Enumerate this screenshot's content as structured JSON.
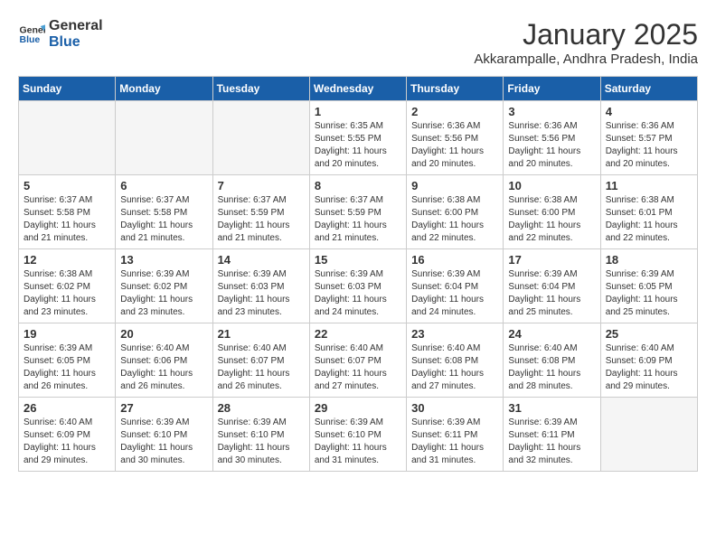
{
  "header": {
    "logo_general": "General",
    "logo_blue": "Blue",
    "month": "January 2025",
    "location": "Akkarampalle, Andhra Pradesh, India"
  },
  "weekdays": [
    "Sunday",
    "Monday",
    "Tuesday",
    "Wednesday",
    "Thursday",
    "Friday",
    "Saturday"
  ],
  "weeks": [
    [
      {
        "day": "",
        "empty": true
      },
      {
        "day": "",
        "empty": true
      },
      {
        "day": "",
        "empty": true
      },
      {
        "day": "1",
        "sunrise": "6:35 AM",
        "sunset": "5:55 PM",
        "daylight": "11 hours and 20 minutes."
      },
      {
        "day": "2",
        "sunrise": "6:36 AM",
        "sunset": "5:56 PM",
        "daylight": "11 hours and 20 minutes."
      },
      {
        "day": "3",
        "sunrise": "6:36 AM",
        "sunset": "5:56 PM",
        "daylight": "11 hours and 20 minutes."
      },
      {
        "day": "4",
        "sunrise": "6:36 AM",
        "sunset": "5:57 PM",
        "daylight": "11 hours and 20 minutes."
      }
    ],
    [
      {
        "day": "5",
        "sunrise": "6:37 AM",
        "sunset": "5:58 PM",
        "daylight": "11 hours and 21 minutes."
      },
      {
        "day": "6",
        "sunrise": "6:37 AM",
        "sunset": "5:58 PM",
        "daylight": "11 hours and 21 minutes."
      },
      {
        "day": "7",
        "sunrise": "6:37 AM",
        "sunset": "5:59 PM",
        "daylight": "11 hours and 21 minutes."
      },
      {
        "day": "8",
        "sunrise": "6:37 AM",
        "sunset": "5:59 PM",
        "daylight": "11 hours and 21 minutes."
      },
      {
        "day": "9",
        "sunrise": "6:38 AM",
        "sunset": "6:00 PM",
        "daylight": "11 hours and 22 minutes."
      },
      {
        "day": "10",
        "sunrise": "6:38 AM",
        "sunset": "6:00 PM",
        "daylight": "11 hours and 22 minutes."
      },
      {
        "day": "11",
        "sunrise": "6:38 AM",
        "sunset": "6:01 PM",
        "daylight": "11 hours and 22 minutes."
      }
    ],
    [
      {
        "day": "12",
        "sunrise": "6:38 AM",
        "sunset": "6:02 PM",
        "daylight": "11 hours and 23 minutes."
      },
      {
        "day": "13",
        "sunrise": "6:39 AM",
        "sunset": "6:02 PM",
        "daylight": "11 hours and 23 minutes."
      },
      {
        "day": "14",
        "sunrise": "6:39 AM",
        "sunset": "6:03 PM",
        "daylight": "11 hours and 23 minutes."
      },
      {
        "day": "15",
        "sunrise": "6:39 AM",
        "sunset": "6:03 PM",
        "daylight": "11 hours and 24 minutes."
      },
      {
        "day": "16",
        "sunrise": "6:39 AM",
        "sunset": "6:04 PM",
        "daylight": "11 hours and 24 minutes."
      },
      {
        "day": "17",
        "sunrise": "6:39 AM",
        "sunset": "6:04 PM",
        "daylight": "11 hours and 25 minutes."
      },
      {
        "day": "18",
        "sunrise": "6:39 AM",
        "sunset": "6:05 PM",
        "daylight": "11 hours and 25 minutes."
      }
    ],
    [
      {
        "day": "19",
        "sunrise": "6:39 AM",
        "sunset": "6:05 PM",
        "daylight": "11 hours and 26 minutes."
      },
      {
        "day": "20",
        "sunrise": "6:40 AM",
        "sunset": "6:06 PM",
        "daylight": "11 hours and 26 minutes."
      },
      {
        "day": "21",
        "sunrise": "6:40 AM",
        "sunset": "6:07 PM",
        "daylight": "11 hours and 26 minutes."
      },
      {
        "day": "22",
        "sunrise": "6:40 AM",
        "sunset": "6:07 PM",
        "daylight": "11 hours and 27 minutes."
      },
      {
        "day": "23",
        "sunrise": "6:40 AM",
        "sunset": "6:08 PM",
        "daylight": "11 hours and 27 minutes."
      },
      {
        "day": "24",
        "sunrise": "6:40 AM",
        "sunset": "6:08 PM",
        "daylight": "11 hours and 28 minutes."
      },
      {
        "day": "25",
        "sunrise": "6:40 AM",
        "sunset": "6:09 PM",
        "daylight": "11 hours and 29 minutes."
      }
    ],
    [
      {
        "day": "26",
        "sunrise": "6:40 AM",
        "sunset": "6:09 PM",
        "daylight": "11 hours and 29 minutes."
      },
      {
        "day": "27",
        "sunrise": "6:39 AM",
        "sunset": "6:10 PM",
        "daylight": "11 hours and 30 minutes."
      },
      {
        "day": "28",
        "sunrise": "6:39 AM",
        "sunset": "6:10 PM",
        "daylight": "11 hours and 30 minutes."
      },
      {
        "day": "29",
        "sunrise": "6:39 AM",
        "sunset": "6:10 PM",
        "daylight": "11 hours and 31 minutes."
      },
      {
        "day": "30",
        "sunrise": "6:39 AM",
        "sunset": "6:11 PM",
        "daylight": "11 hours and 31 minutes."
      },
      {
        "day": "31",
        "sunrise": "6:39 AM",
        "sunset": "6:11 PM",
        "daylight": "11 hours and 32 minutes."
      },
      {
        "day": "",
        "empty": true
      }
    ]
  ]
}
